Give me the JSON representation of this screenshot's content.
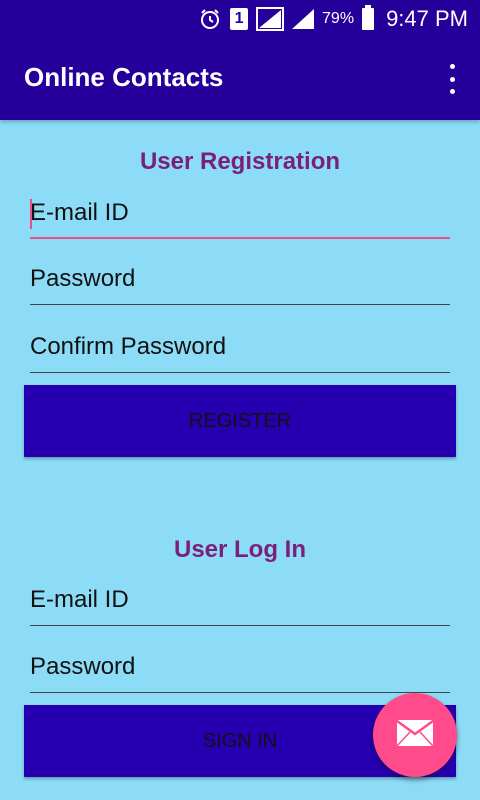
{
  "status_bar": {
    "sim_label": "1",
    "battery_percent": "79%",
    "time": "9:47 PM",
    "icons": [
      "alarm-icon",
      "sim-icon",
      "signal-icon",
      "signal-icon",
      "battery-icon"
    ]
  },
  "app_bar": {
    "title": "Online Contacts",
    "overflow_icon": "more-vert-icon"
  },
  "registration": {
    "title": "User Registration",
    "email_placeholder": "E-mail ID",
    "password_placeholder": "Password",
    "confirm_password_placeholder": "Confirm Password",
    "button_label": "REGISTER"
  },
  "login": {
    "title": "User Log In",
    "email_placeholder": "E-mail ID",
    "password_placeholder": "Password",
    "button_label": "SIGN IN"
  },
  "fab": {
    "icon": "mail-icon"
  },
  "colors": {
    "primary": "#26009a",
    "background": "#8ddcf7",
    "section_title": "#7a1f7a",
    "accent": "#ec4f86",
    "fab": "#ff4b8c"
  }
}
